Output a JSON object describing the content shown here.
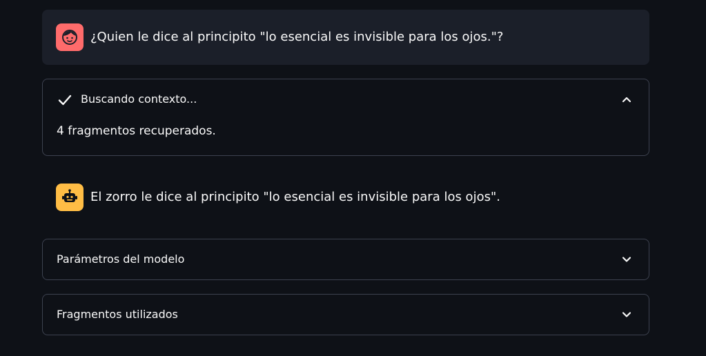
{
  "user_message": {
    "avatar_icon": "face-icon",
    "avatar_color": "#ff6b6b",
    "text": "¿Quien le dice al principito \"lo esencial es invisible para los ojos.\"?"
  },
  "status": {
    "icon": "check-icon",
    "label": "Buscando contexto...",
    "expanded": true,
    "body": "4 fragmentos recuperados."
  },
  "assistant_message": {
    "avatar_icon": "robot-icon",
    "avatar_color": "#ffbd45",
    "text": "El zorro le dice al principito \"lo esencial es invisible para los ojos\"."
  },
  "expanders": {
    "params_label": "Parámetros del modelo",
    "fragments_label": "Fragmentos utilizados"
  },
  "colors": {
    "background": "#0e1117",
    "user_bubble": "#1b1f29",
    "border": "#3d4250",
    "text": "#fafafa"
  }
}
